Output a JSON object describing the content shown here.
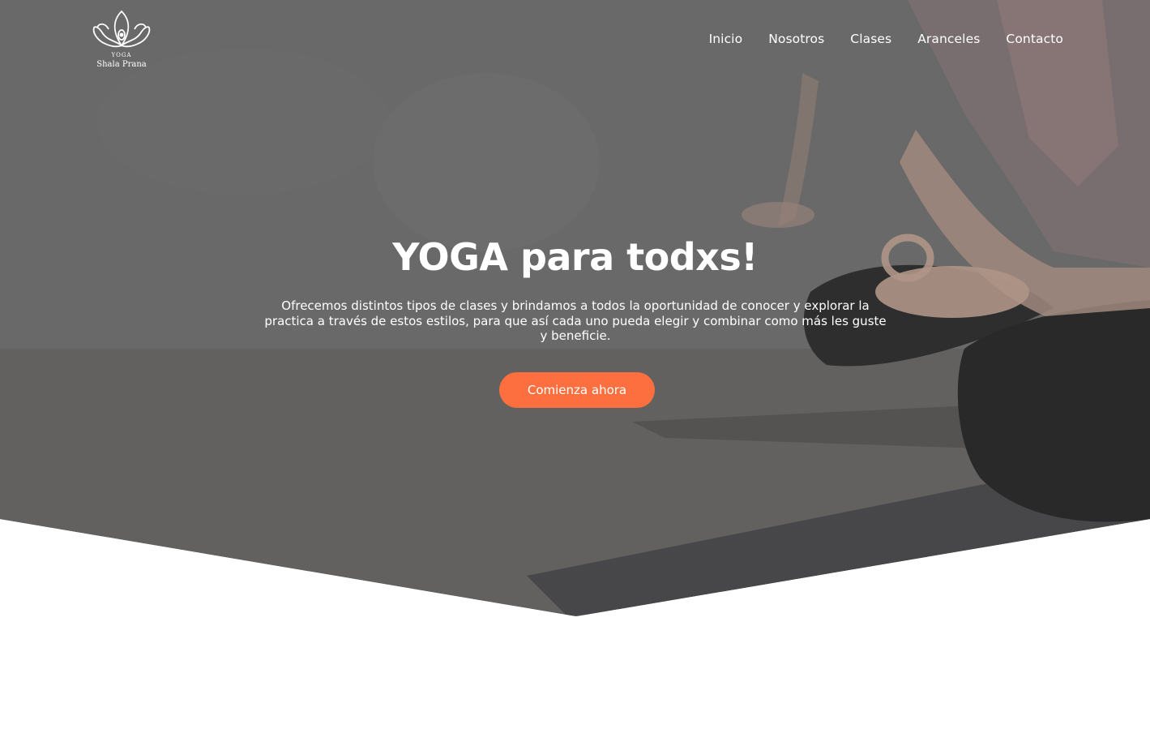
{
  "brand": {
    "logo_small": "YOGA",
    "logo_name": "Shala Prana"
  },
  "nav": {
    "items": [
      {
        "label": "Inicio"
      },
      {
        "label": "Nosotros"
      },
      {
        "label": "Clases"
      },
      {
        "label": "Aranceles"
      },
      {
        "label": "Contacto"
      }
    ]
  },
  "hero": {
    "title": "YOGA para todxs!",
    "text": "Ofrecemos distintos tipos de clases y brindamos a todos la oportunidad de conocer y explorar la practica a través de estos estilos, para que así cada uno pueda elegir y combinar como más les guste y beneficie.",
    "cta_label": "Comienza ahora"
  },
  "colors": {
    "accent": "#fd6f3e",
    "hero_overlay": "#6e6e6e",
    "text_on_hero": "#ffffff",
    "page_background": "#ffffff"
  }
}
